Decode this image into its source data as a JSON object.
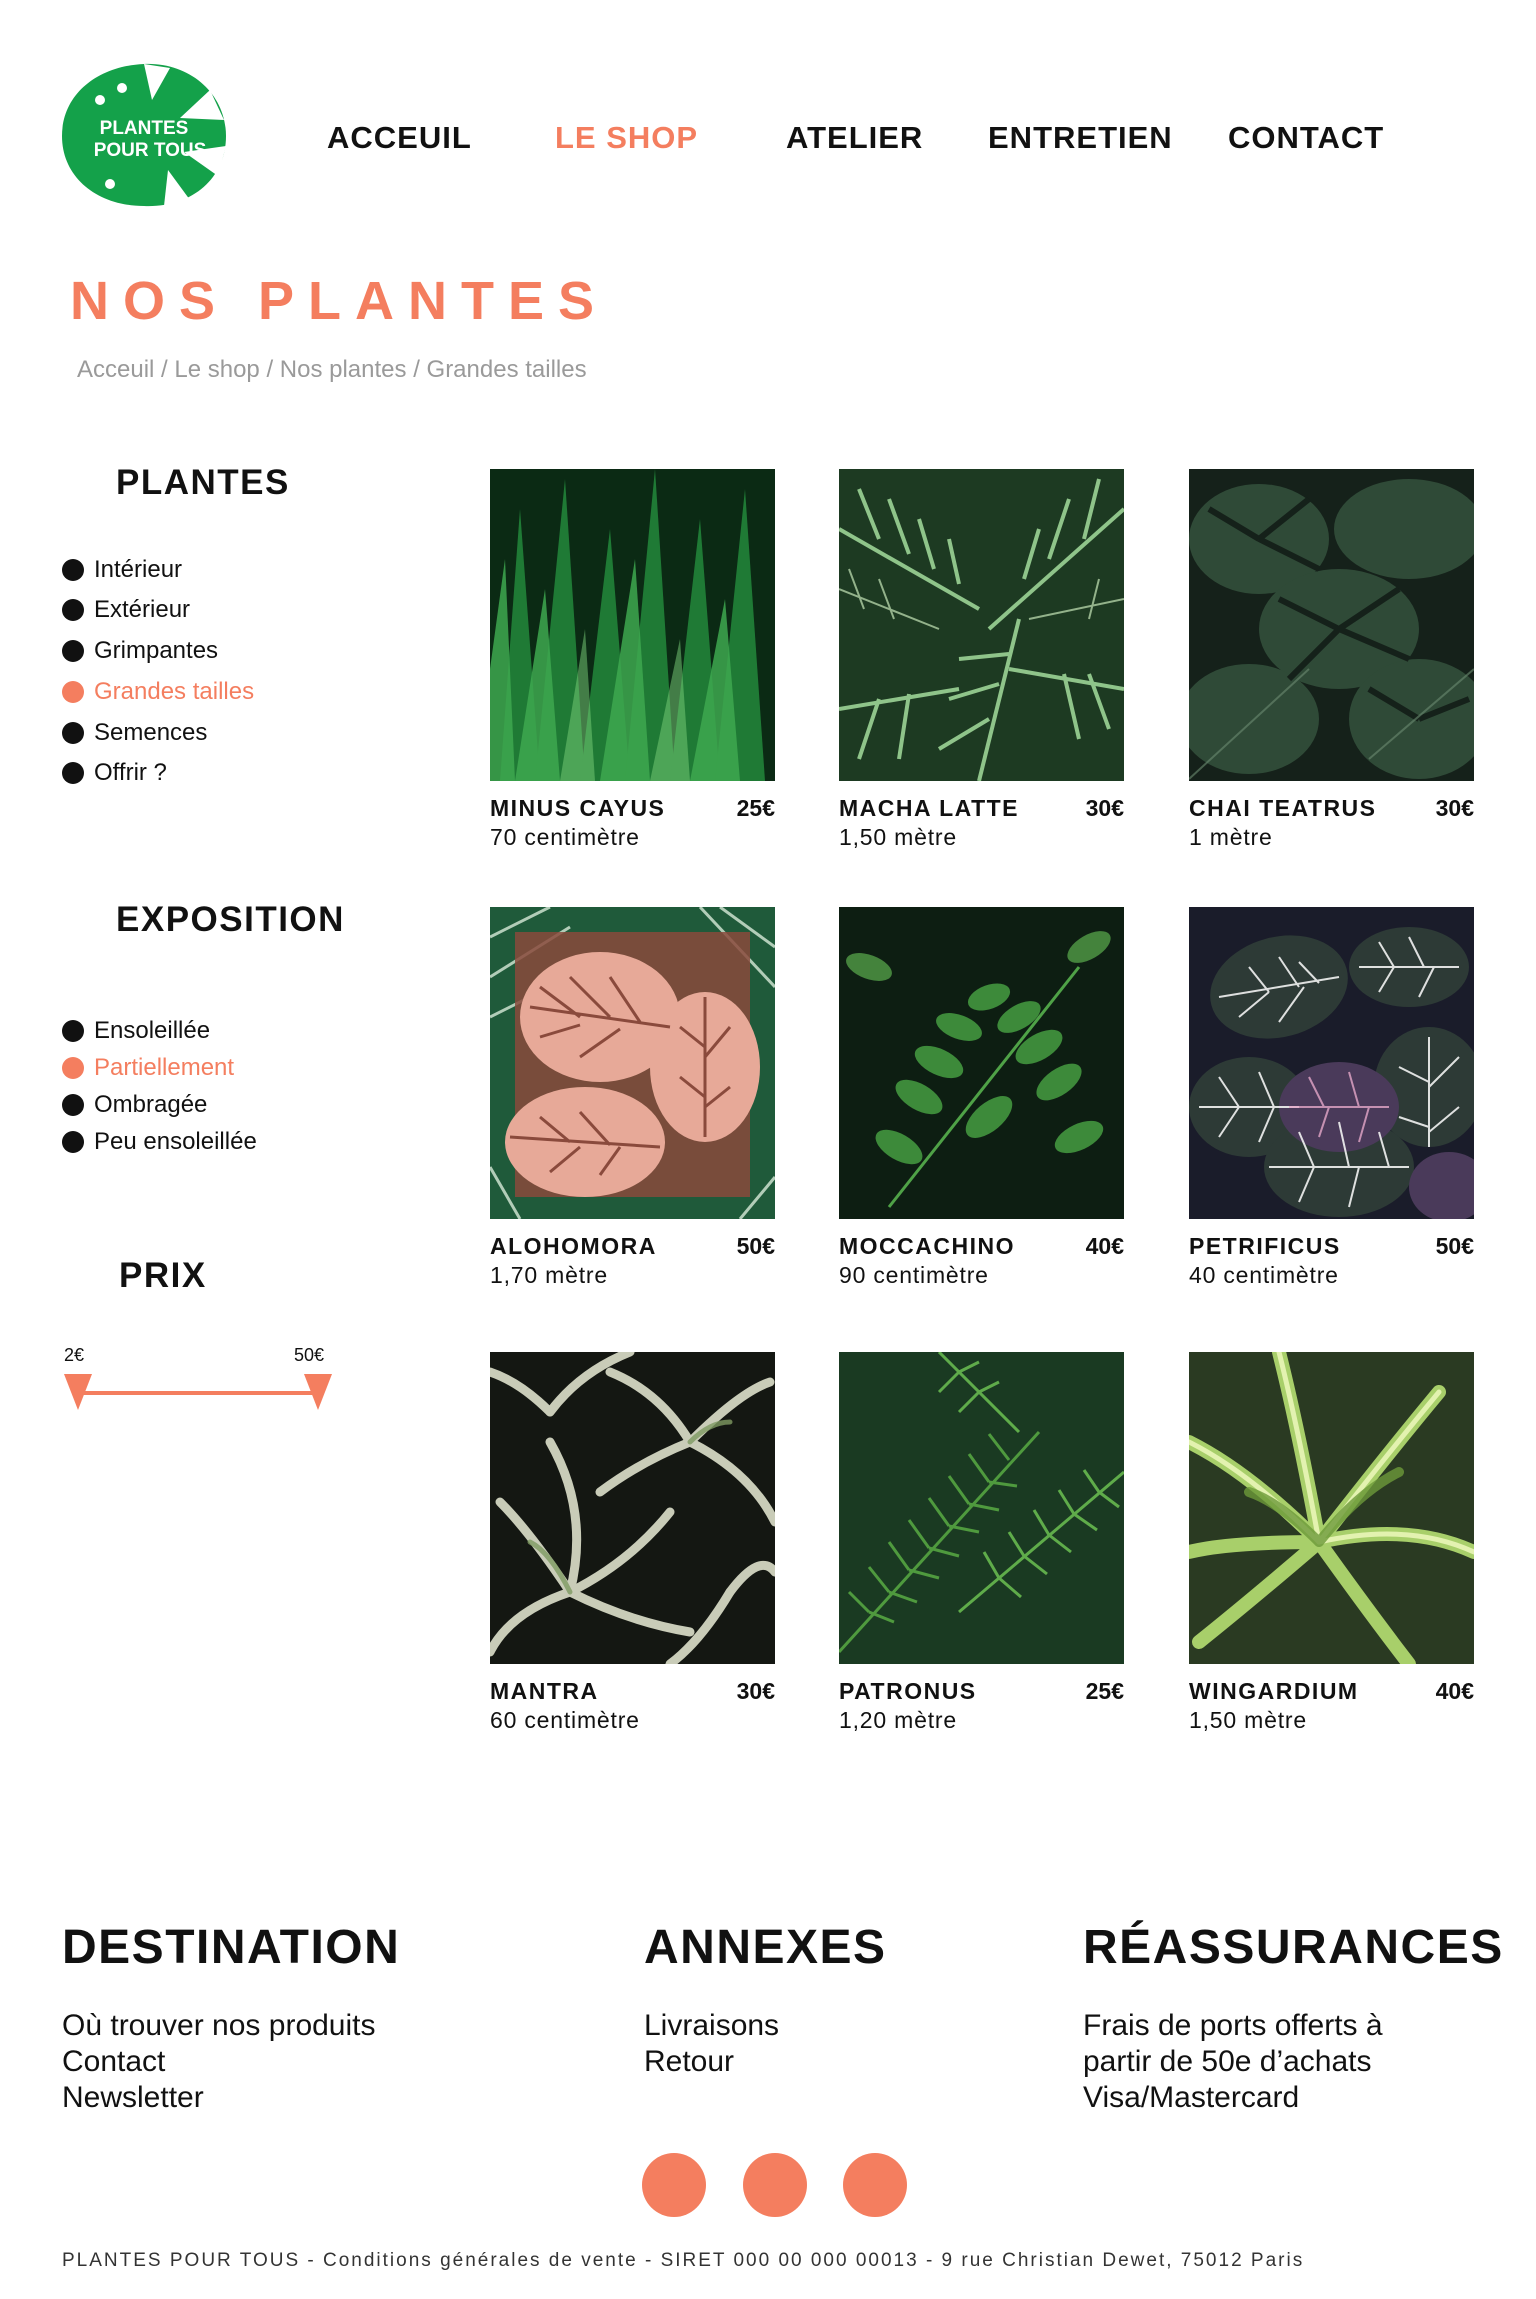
{
  "brand": {
    "logo_text_line1": "PLANTES",
    "logo_text_line2": "POUR TOUS",
    "color_green": "#14a14a",
    "color_accent": "#f47e5f"
  },
  "nav": [
    {
      "label": "ACCEUIL",
      "active": false
    },
    {
      "label": "LE SHOP",
      "active": true
    },
    {
      "label": "ATELIER",
      "active": false
    },
    {
      "label": "ENTRETIEN",
      "active": false
    },
    {
      "label": "CONTACT",
      "active": false
    }
  ],
  "page_title": "NOS PLANTES",
  "breadcrumb": "Acceuil / Le shop / Nos plantes / Grandes tailles",
  "sidebar": {
    "plantes": {
      "heading": "PLANTES",
      "items": [
        {
          "label": "Intérieur",
          "active": false
        },
        {
          "label": "Extérieur",
          "active": false
        },
        {
          "label": "Grimpantes",
          "active": false
        },
        {
          "label": "Grandes tailles",
          "active": true
        },
        {
          "label": "Semences",
          "active": false
        },
        {
          "label": "Offrir ?",
          "active": false
        }
      ]
    },
    "exposition": {
      "heading": "EXPOSITION",
      "items": [
        {
          "label": "Ensoleillée",
          "active": false
        },
        {
          "label": "Partiellement",
          "active": true
        },
        {
          "label": "Ombragée",
          "active": false
        },
        {
          "label": "Peu ensoleillée",
          "active": false
        }
      ]
    },
    "prix": {
      "heading": "PRIX",
      "min_label": "2€",
      "max_label": "50€"
    }
  },
  "products": [
    {
      "name": "MINUS CAYUS",
      "price": "25€",
      "size": "70 centimètre",
      "image": "snake-plant-leaves"
    },
    {
      "name": "MACHA LATTE",
      "price": "30€",
      "size": "1,50 mètre",
      "image": "palm-fronds"
    },
    {
      "name": "CHAI TEATRUS",
      "price": "30€",
      "size": "1 mètre",
      "image": "monstera-dark"
    },
    {
      "name": "ALOHOMORA",
      "price": "50€",
      "size": "1,70 mètre",
      "image": "calathea-pink"
    },
    {
      "name": "MOCCACHINO",
      "price": "40€",
      "size": "90 centimètre",
      "image": "fern-leaves"
    },
    {
      "name": "PETRIFICUS",
      "price": "50€",
      "size": "40 centimètre",
      "image": "fittonia-veined"
    },
    {
      "name": "MANTRA",
      "price": "30€",
      "size": "60 centimètre",
      "image": "air-plant-silver"
    },
    {
      "name": "PATRONUS",
      "price": "25€",
      "size": "1,20 mètre",
      "image": "fern-fronds"
    },
    {
      "name": "WINGARDIUM",
      "price": "40€",
      "size": "1,50 mètre",
      "image": "spider-plant"
    }
  ],
  "footer": {
    "destination": {
      "heading": "DESTINATION",
      "links": [
        "Où trouver nos produits",
        "Contact",
        "Newsletter"
      ]
    },
    "annexes": {
      "heading": "ANNEXES",
      "links": [
        "Livraisons",
        "Retour"
      ]
    },
    "reassurances": {
      "heading": "RÉASSURANCES",
      "lines": [
        "Frais de ports offerts à",
        "partir de 50e d’achats",
        "Visa/Mastercard"
      ]
    },
    "legal": "PLANTES POUR TOUS - Conditions générales de vente - SIRET 000 00 000 00013 - 9 rue Christian Dewet, 75012 Paris"
  }
}
